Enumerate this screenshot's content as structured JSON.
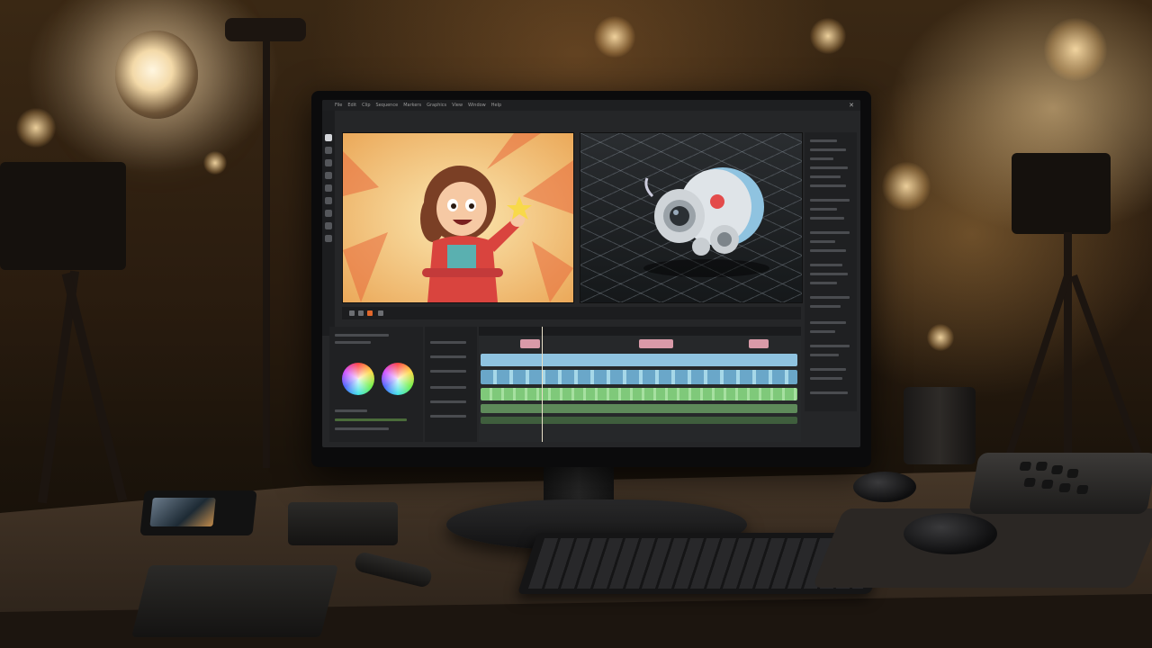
{
  "app": {
    "menu_items": [
      "File",
      "Edit",
      "Clip",
      "Sequence",
      "Markers",
      "Graphics",
      "View",
      "Window",
      "Help"
    ],
    "close_icon": "close-icon"
  },
  "toolbar": {
    "tools": [
      "selection-icon",
      "track-select-icon",
      "ripple-edit-icon",
      "razor-icon",
      "slip-icon",
      "pen-icon",
      "hand-icon",
      "zoom-icon",
      "type-icon"
    ]
  },
  "viewers": {
    "left_content": "2D cartoon character",
    "right_content": "3D robot model"
  },
  "color_panel": {
    "wheels": [
      "color-wheel-shadows",
      "color-wheel-highlights"
    ]
  },
  "timeline": {
    "tracks": [
      "V3",
      "V2",
      "V1",
      "A1",
      "A2",
      "A3"
    ],
    "colors": {
      "video_track": "#8fc3e0",
      "clip_blue": "#6aa7c9",
      "clip_green": "#7fc97a",
      "clip_pink": "#d99aa8",
      "record": "#e2672b"
    }
  }
}
